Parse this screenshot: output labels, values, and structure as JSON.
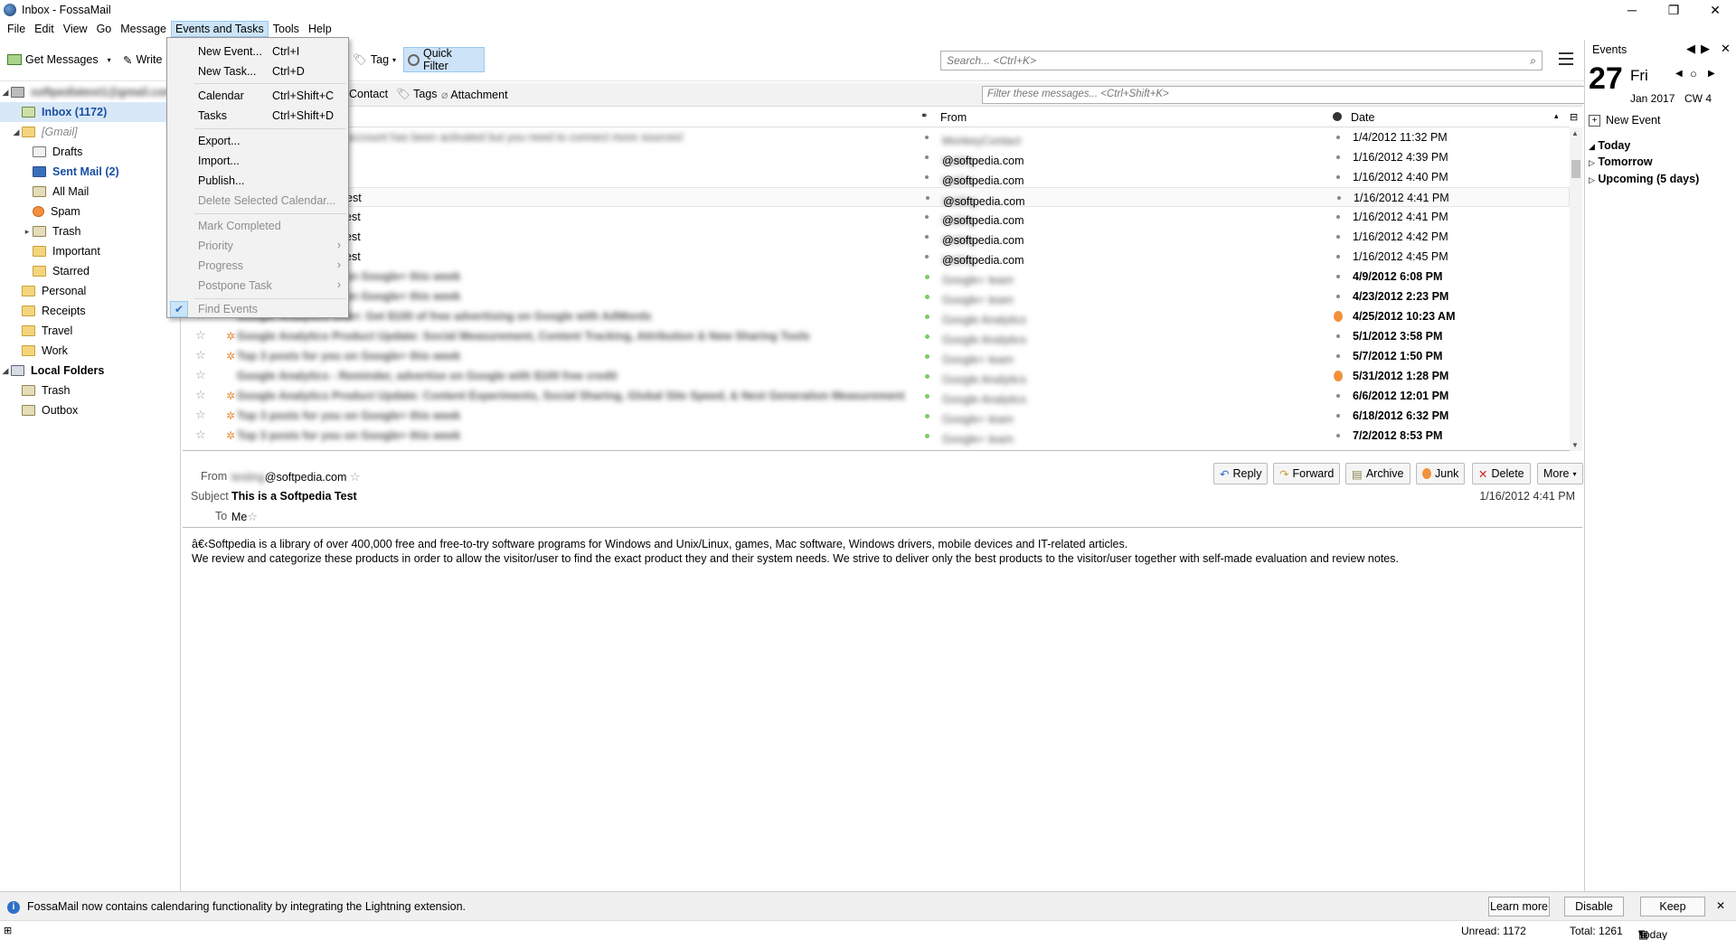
{
  "window": {
    "title": "Inbox - FossaMail",
    "minimize": "─",
    "restore": "❐",
    "close": "✕"
  },
  "menubar": [
    "File",
    "Edit",
    "View",
    "Go",
    "Message",
    "Events and Tasks",
    "Tools",
    "Help"
  ],
  "toolbar": {
    "get_messages": "Get Messages",
    "write": "Write",
    "tag": "Tag",
    "quick_filter": "Quick Filter",
    "search_placeholder": "Search... <Ctrl+K>"
  },
  "events_menu": {
    "items": [
      {
        "label": "New Event...",
        "shortcut": "Ctrl+I"
      },
      {
        "label": "New Task...",
        "shortcut": "Ctrl+D"
      },
      {
        "label": "Calendar",
        "shortcut": "Ctrl+Shift+C"
      },
      {
        "label": "Tasks",
        "shortcut": "Ctrl+Shift+D"
      },
      {
        "label": "Export..."
      },
      {
        "label": "Import..."
      },
      {
        "label": "Publish..."
      },
      {
        "label": "Delete Selected Calendar..."
      },
      {
        "label": "Mark Completed"
      },
      {
        "label": "Priority"
      },
      {
        "label": "Progress"
      },
      {
        "label": "Postpone Task"
      },
      {
        "label": "Find Events"
      }
    ]
  },
  "folders": {
    "account": "softpediatest1@gmail.com",
    "inbox": "Inbox (1172)",
    "gmail": "[Gmail]",
    "drafts": "Drafts",
    "sent": "Sent Mail (2)",
    "all_mail": "All Mail",
    "spam": "Spam",
    "trash": "Trash",
    "important": "Important",
    "starred": "Starred",
    "personal": "Personal",
    "receipts": "Receipts",
    "travel": "Travel",
    "work": "Work",
    "local_folders": "Local Folders",
    "local_trash": "Trash",
    "outbox": "Outbox"
  },
  "quick_filter_bar": {
    "contact": "Contact",
    "tags": "Tags",
    "attachment": "Attachment",
    "filter_placeholder": "Filter these messages... <Ctrl+Shift+K>"
  },
  "thread_columns": {
    "from": "From",
    "date": "Date"
  },
  "messages": [
    {
      "subject": "MonkeyContact: Your account has been activated but you need to connect more sources!",
      "from_blur": "MonkeyContact",
      "from_domain": "",
      "date": "1/4/2012 11:32 PM",
      "bold": false
    },
    {
      "subject": "",
      "from_blur": "testing",
      "from_domain": "@softpedia.com",
      "date": "1/16/2012 4:39 PM",
      "bold": false
    },
    {
      "subject": "",
      "from_blur": "testing",
      "from_domain": "@softpedia.com",
      "date": "1/16/2012 4:40 PM",
      "bold": false
    },
    {
      "subject": "est",
      "from_blur": "testing",
      "from_domain": "@softpedia.com",
      "date": "1/16/2012 4:41 PM",
      "bold": false
    },
    {
      "subject": "est",
      "from_blur": "testing",
      "from_domain": "@softpedia.com",
      "date": "1/16/2012 4:41 PM",
      "bold": false
    },
    {
      "subject": "est",
      "from_blur": "testing",
      "from_domain": "@softpedia.com",
      "date": "1/16/2012 4:42 PM",
      "bold": false
    },
    {
      "subject": "est",
      "from_blur": "testing",
      "from_domain": "@softpedia.com",
      "date": "1/16/2012 4:45 PM",
      "bold": false
    },
    {
      "subject": "Top 3 posts for you on Google+ this week",
      "from_blur": "Google+ team",
      "from_domain": "",
      "date": "4/9/2012 6:08 PM",
      "bold": true
    },
    {
      "subject": "Top 3 posts for you on Google+ this week",
      "from_blur": "Google+ team",
      "from_domain": "",
      "date": "4/23/2012 2:23 PM",
      "bold": true
    },
    {
      "subject": "Google Analytics Offer: Get $100 of free advertising on Google with AdWords",
      "from_blur": "Google Analytics",
      "from_domain": "",
      "date": "4/25/2012 10:23 AM",
      "bold": true
    },
    {
      "subject": "Google Analytics Product Update: Social Measurement, Content Tracking, Attribution & New Sharing Tools",
      "from_blur": "Google Analytics",
      "from_domain": "",
      "date": "5/1/2012 3:58 PM",
      "bold": true
    },
    {
      "subject": "Top 3 posts for you on Google+ this week",
      "from_blur": "Google+ team",
      "from_domain": "",
      "date": "5/7/2012 1:50 PM",
      "bold": true
    },
    {
      "subject": "Google Analytics - Reminder, advertise on Google with $100 free credit",
      "from_blur": "Google Analytics",
      "from_domain": "",
      "date": "5/31/2012 1:28 PM",
      "bold": true
    },
    {
      "subject": "Google Analytics Product Update: Content Experiments, Social Sharing, Global Site Speed, & Next Generation Measurement",
      "from_blur": "Google Analytics",
      "from_domain": "",
      "date": "6/6/2012 12:01 PM",
      "bold": true
    },
    {
      "subject": "Top 3 posts for you on Google+ this week",
      "from_blur": "Google+ team",
      "from_domain": "",
      "date": "6/18/2012 6:32 PM",
      "bold": true
    },
    {
      "subject": "Top 3 posts for you on Google+ this week",
      "from_blur": "Google+ team",
      "from_domain": "",
      "date": "7/2/2012 8:53 PM",
      "bold": true
    }
  ],
  "message_header": {
    "from_label": "From",
    "from_blur": "testing",
    "from_domain": "@softpedia.com",
    "subject_label": "Subject",
    "subject": "This is a Softpedia Test",
    "to_label": "To",
    "to": "Me",
    "date": "1/16/2012 4:41 PM",
    "buttons": {
      "reply": "Reply",
      "forward": "Forward",
      "archive": "Archive",
      "junk": "Junk",
      "delete": "Delete",
      "more": "More"
    }
  },
  "message_body": {
    "line1": "â€‹Softpedia is a library of over 400,000 free and free-to-try software programs for Windows and Unix/Linux, games, Mac software, Windows drivers, mobile devices and IT-related articles.",
    "line2": "We review and categorize these products in order to allow the visitor/user to find the exact product they and their system needs. We strive to deliver only the best products to the visitor/user together with self-made evaluation and review notes."
  },
  "today_pane": {
    "header": "Events",
    "day_number": "27",
    "weekday": "Fri",
    "month_year": "Jan 2017",
    "cw": "CW 4",
    "new_event": "New Event",
    "today": "Today",
    "tomorrow": "Tomorrow",
    "upcoming": "Upcoming (5 days)"
  },
  "notification": {
    "message": "FossaMail now contains calendaring functionality by integrating the Lightning extension.",
    "learn_more": "Learn more",
    "disable": "Disable",
    "keep": "Keep",
    "close": "✕"
  },
  "statusbar": {
    "unread": "Unread: 1172",
    "total": "Total: 1261",
    "today_pane": "Today Pane"
  }
}
